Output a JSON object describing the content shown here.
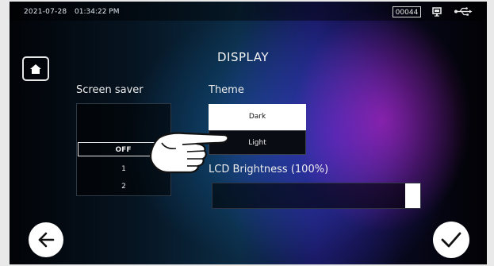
{
  "status_bar": {
    "date": "2021-07-28",
    "time": "01:34:22 PM",
    "counter": "00044",
    "icons": [
      "monitor-icon",
      "usb-icon"
    ]
  },
  "page": {
    "title": "DISPLAY",
    "home_icon": "home-icon"
  },
  "screen_saver": {
    "label": "Screen saver",
    "options": [
      "OFF",
      "1",
      "2"
    ],
    "selected": "OFF"
  },
  "theme": {
    "label": "Theme",
    "options": [
      "Dark",
      "Light"
    ],
    "highlighted": "Dark"
  },
  "lcd": {
    "label": "LCD Brightness (100%)",
    "brightness_fraction": 1.0
  },
  "footer": {
    "back_icon": "arrow-left-icon",
    "confirm_icon": "checkmark-icon"
  },
  "overlay": {
    "icon": "pointing-hand-icon"
  }
}
